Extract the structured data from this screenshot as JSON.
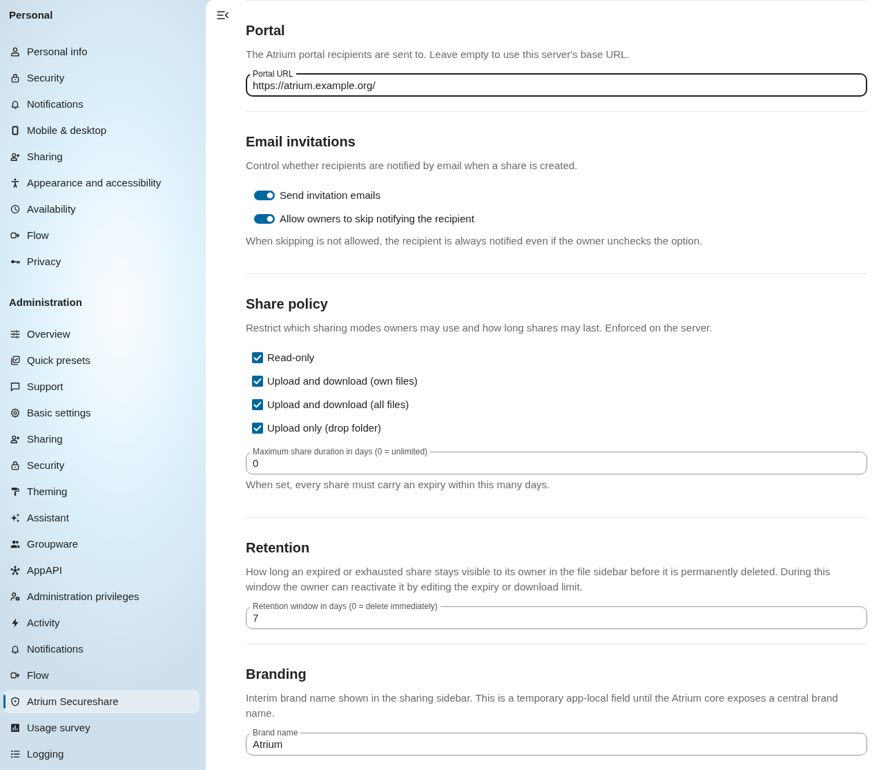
{
  "sidebar": {
    "sections": [
      {
        "heading": "Personal",
        "items": [
          {
            "label": "Personal info",
            "selected": false
          },
          {
            "label": "Security",
            "selected": false
          },
          {
            "label": "Notifications",
            "selected": false
          },
          {
            "label": "Mobile & desktop",
            "selected": false
          },
          {
            "label": "Sharing",
            "selected": false
          },
          {
            "label": "Appearance and accessibility",
            "selected": false
          },
          {
            "label": "Availability",
            "selected": false
          },
          {
            "label": "Flow",
            "selected": false
          },
          {
            "label": "Privacy",
            "selected": false
          }
        ]
      },
      {
        "heading": "Administration",
        "items": [
          {
            "label": "Overview",
            "selected": false
          },
          {
            "label": "Quick presets",
            "selected": false
          },
          {
            "label": "Support",
            "selected": false
          },
          {
            "label": "Basic settings",
            "selected": false
          },
          {
            "label": "Sharing",
            "selected": false
          },
          {
            "label": "Security",
            "selected": false
          },
          {
            "label": "Theming",
            "selected": false
          },
          {
            "label": "Assistant",
            "selected": false
          },
          {
            "label": "Groupware",
            "selected": false
          },
          {
            "label": "AppAPI",
            "selected": false
          },
          {
            "label": "Administration privileges",
            "selected": false
          },
          {
            "label": "Activity",
            "selected": false
          },
          {
            "label": "Notifications",
            "selected": false
          },
          {
            "label": "Flow",
            "selected": false
          },
          {
            "label": "Atrium Secureshare",
            "selected": true
          },
          {
            "label": "Usage survey",
            "selected": false
          },
          {
            "label": "Logging",
            "selected": false
          }
        ]
      }
    ]
  },
  "content": {
    "sections": [
      {
        "title": "Portal",
        "description": "The Atrium portal recipients are sent to. Leave empty to use this server's base URL.",
        "controls": [
          {
            "kind": "field",
            "label": "Portal URL",
            "value": "https://atrium.example.org/",
            "focused": true
          }
        ]
      },
      {
        "title": "Email invitations",
        "description": "Control whether recipients are notified by email when a share is created.",
        "controls": [
          {
            "kind": "toggle",
            "label": "Send invitation emails",
            "on": true
          },
          {
            "kind": "toggle",
            "label": "Allow owners to skip notifying the recipient",
            "on": true
          },
          {
            "kind": "note",
            "text": "When skipping is not allowed, the recipient is always notified even if the owner unchecks the option."
          }
        ]
      },
      {
        "title": "Share policy",
        "description": "Restrict which sharing modes owners may use and how long shares may last. Enforced on the server.",
        "controls": [
          {
            "kind": "checkbox",
            "label": "Read-only",
            "checked": true
          },
          {
            "kind": "checkbox",
            "label": "Upload and download (own files)",
            "checked": true
          },
          {
            "kind": "checkbox",
            "label": "Upload and download (all files)",
            "checked": true
          },
          {
            "kind": "checkbox",
            "label": "Upload only (drop folder)",
            "checked": true
          },
          {
            "kind": "field",
            "label": "Maximum share duration in days (0 = unlimited)",
            "value": "0",
            "focused": false
          },
          {
            "kind": "note",
            "text": "When set, every share must carry an expiry within this many days."
          }
        ]
      },
      {
        "title": "Retention",
        "description": "How long an expired or exhausted share stays visible to its owner in the file sidebar before it is permanently deleted. During this window the owner can reactivate it by editing the expiry or download limit.",
        "controls": [
          {
            "kind": "field",
            "label": "Retention window in days (0 = delete immediately)",
            "value": "7",
            "focused": false
          }
        ]
      },
      {
        "title": "Branding",
        "description": "Interim brand name shown in the sharing sidebar. This is a temporary app-local field until the Atrium core exposes a central brand name.",
        "controls": [
          {
            "kind": "field",
            "label": "Brand name",
            "value": "Atrium",
            "focused": false
          }
        ]
      }
    ]
  }
}
